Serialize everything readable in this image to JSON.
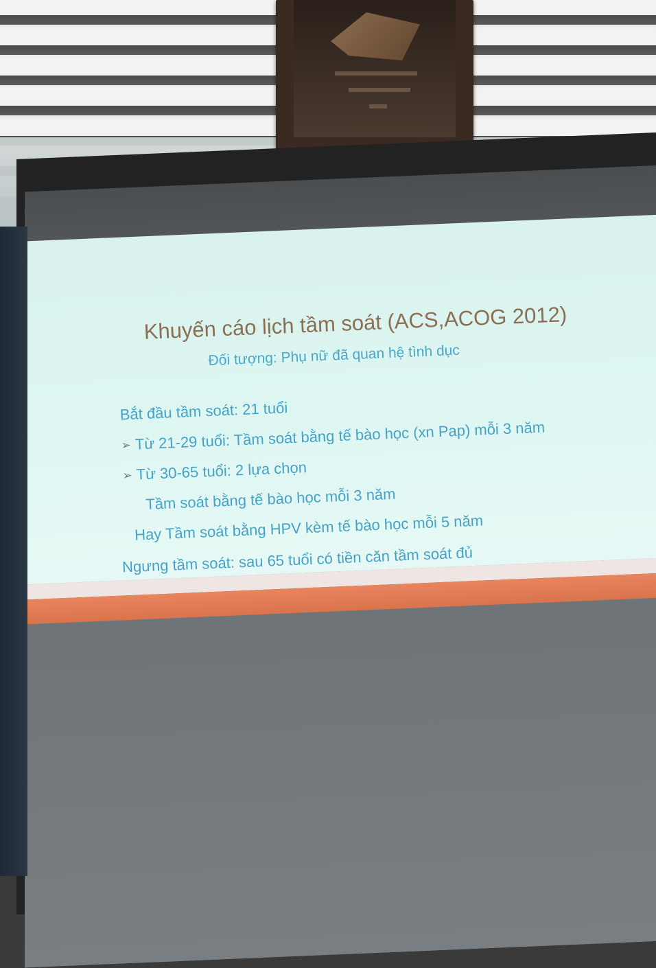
{
  "slide": {
    "title": "Khuyến cáo lịch tầm soát (ACS,ACOG 2012)",
    "subtitle": "Đối tượng: Phụ nữ đã quan hệ tình dục",
    "lines": [
      {
        "text": "Bắt đầu tầm soát: 21 tuổi",
        "bullet": ""
      },
      {
        "text": "Từ 21-29 tuổi:  Tầm soát bằng tế bào học (xn Pap) mỗi 3 năm",
        "bullet": "➢"
      },
      {
        "text": "Từ 30-65 tuổi: 2 lựa chọn",
        "bullet": "➢"
      },
      {
        "text": "Tầm soát bằng tế bào học mỗi 3 năm",
        "bullet": ""
      },
      {
        "text": "Hay Tầm soát bằng HPV kèm tế bào học mỗi 5 năm",
        "bullet": ""
      },
      {
        "text": "Ngưng tầm soát: sau 65 tuổi có tiền căn tầm soát đủ",
        "bullet": ""
      }
    ]
  },
  "colors": {
    "title": "#8b6f52",
    "body_text": "#45a3c6",
    "slide_bg": "#ddf6f2",
    "accent_stripe": "#e8845e"
  }
}
